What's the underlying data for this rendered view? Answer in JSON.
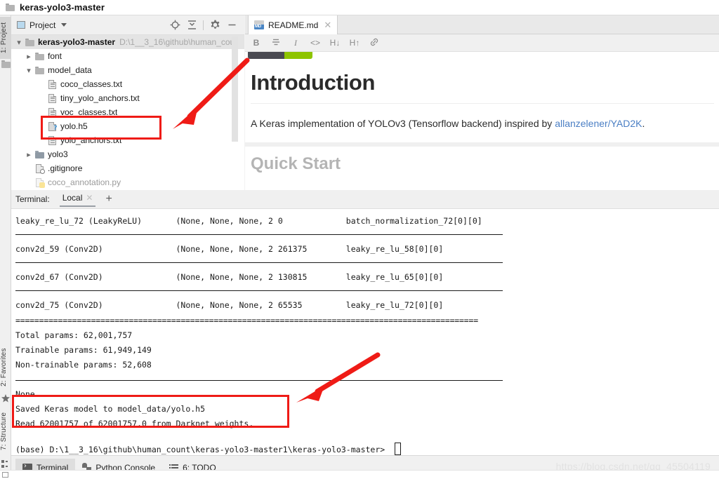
{
  "window": {
    "title": "keras-yolo3-master",
    "icon": "folder-icon"
  },
  "left_strip": [
    {
      "label": "1: Project",
      "icon": "project-icon",
      "selected": true
    },
    {
      "label": "2: Favorites",
      "icon": "star-icon",
      "selected": false
    },
    {
      "label": "7: Structure",
      "icon": "structure-icon",
      "selected": false
    }
  ],
  "project_panel": {
    "title": "Project",
    "dropdown_icon": "chevron-down-icon",
    "toolbar_icons": [
      "locate-target-icon",
      "collapse-all-icon",
      "settings-gear-icon",
      "minimize-icon"
    ],
    "tree": [
      {
        "name": "keras-yolo3-master",
        "path": "D:\\1__3_16\\github\\human_cou",
        "icon": "folder-icon",
        "arrow": "expanded",
        "depth": 0,
        "header": true
      },
      {
        "name": "font",
        "icon": "folder-icon",
        "arrow": "collapsed",
        "depth": 1
      },
      {
        "name": "model_data",
        "icon": "folder-icon",
        "arrow": "expanded",
        "depth": 1
      },
      {
        "name": "coco_classes.txt",
        "icon": "text-file-icon",
        "arrow": "none",
        "depth": 2
      },
      {
        "name": "tiny_yolo_anchors.txt",
        "icon": "text-file-icon",
        "arrow": "none",
        "depth": 2
      },
      {
        "name": "voc_classes.txt",
        "icon": "text-file-icon",
        "arrow": "none",
        "depth": 2
      },
      {
        "name": "yolo.h5",
        "icon": "unknown-file-icon",
        "arrow": "none",
        "depth": 2,
        "highlighted": true
      },
      {
        "name": "yolo_anchors.txt",
        "icon": "text-file-icon",
        "arrow": "none",
        "depth": 2
      },
      {
        "name": "yolo3",
        "icon": "python-package-icon",
        "arrow": "collapsed",
        "depth": 1
      },
      {
        "name": ".gitignore",
        "icon": "gitignore-file-icon",
        "arrow": "none",
        "depth": 1
      },
      {
        "name": "coco_annotation.py",
        "icon": "python-file-icon",
        "arrow": "none",
        "depth": 1
      }
    ]
  },
  "editor": {
    "tab": {
      "label": "README.md",
      "icon": "markdown-file-icon",
      "close_icon": "close-icon"
    },
    "md_toolbar": [
      {
        "name": "bold",
        "glyph": "B"
      },
      {
        "name": "strikethrough",
        "glyph": "S"
      },
      {
        "name": "italic",
        "glyph": "I"
      },
      {
        "name": "code",
        "glyph": "<>"
      },
      {
        "name": "heading-down",
        "glyph": "H↓"
      },
      {
        "name": "heading-up",
        "glyph": "H↑"
      },
      {
        "name": "link",
        "glyph": "🔗"
      }
    ],
    "preview": {
      "heading": "Introduction",
      "paragraph_prefix": "A Keras implementation of YOLOv3 (Tensorflow backend) inspired by ",
      "paragraph_link": "allanzelener/YAD2K",
      "paragraph_suffix": ".",
      "next_heading_partial": "Quick Start"
    }
  },
  "terminal": {
    "label": "Terminal:",
    "tab": "Local",
    "close_icon": "close-icon",
    "add_icon": "plus-icon",
    "lines": [
      {
        "text": "leaky_re_lu_72 (LeakyReLU)       (None, None, None, 2 0             batch_normalization_72[0][0]"
      },
      {
        "text": "conv2d_59 (Conv2D)               (None, None, None, 2 261375        leaky_re_lu_58[0][0]"
      },
      {
        "text": "conv2d_67 (Conv2D)               (None, None, None, 2 130815        leaky_re_lu_65[0][0]"
      },
      {
        "text": "conv2d_75 (Conv2D)               (None, None, None, 2 65535         leaky_re_lu_72[0][0]"
      },
      {
        "text": "=================================================================================================="
      },
      {
        "text": "Total params: 62,001,757"
      },
      {
        "text": "Trainable params: 61,949,149"
      },
      {
        "text": "Non-trainable params: 52,608"
      },
      {
        "text": "None"
      },
      {
        "text": "Saved Keras model to model_data/yolo.h5"
      },
      {
        "text": "Read 62001757 of 62001757.0 from Darknet weights."
      }
    ],
    "prompt": "(base) D:\\1__3_16\\github\\human_count\\keras-yolo3-master1\\keras-yolo3-master>"
  },
  "status_bar": {
    "items": [
      {
        "label": "Terminal",
        "icon": "terminal-icon",
        "selected": true
      },
      {
        "label": "Python Console",
        "icon": "python-icon",
        "selected": false
      },
      {
        "label": "6: TODO",
        "icon": "todo-list-icon",
        "selected": false,
        "mnemonic": "6"
      }
    ]
  },
  "watermark": "https://blog.csdn.net/qq_45504119",
  "colors": {
    "annotation_red": "#ef1b16",
    "link_blue": "#4b7fc4",
    "selection_gray": "#e4e4e4",
    "shield_green": "#8ec400",
    "shield_dark": "#4a4a52"
  }
}
